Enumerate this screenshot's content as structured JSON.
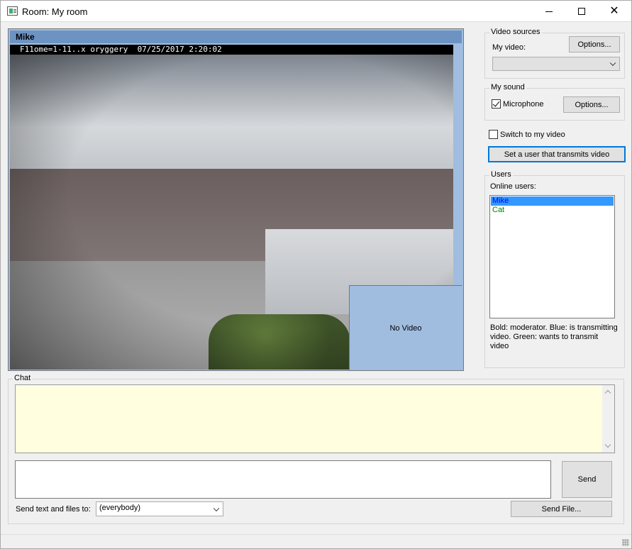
{
  "window": {
    "title": "Room: My room"
  },
  "video": {
    "user_name": "Mike",
    "camera_overlay": "F11ome=1-11..x oryggery  07/25/2017 2:20:02",
    "no_video_label": "No Video"
  },
  "video_sources": {
    "group_label": "Video sources",
    "my_video_label": "My video:",
    "options_label": "Options...",
    "selected": ""
  },
  "my_sound": {
    "group_label": "My sound",
    "microphone_label": "Microphone",
    "microphone_checked": true,
    "options_label": "Options..."
  },
  "switch_to_my_video": {
    "label": "Switch to my video",
    "checked": false
  },
  "set_user_button": "Set a user that transmits video",
  "users": {
    "group_label": "Users",
    "online_label": "Online users:",
    "list": [
      {
        "name": "Mike",
        "state": "transmitting"
      },
      {
        "name": "Cat",
        "state": "wants-to-transmit"
      }
    ],
    "legend": "Bold: moderator. Blue: is transmitting video. Green: wants to transmit video"
  },
  "chat": {
    "group_label": "Chat",
    "log": "",
    "message": "",
    "send_label": "Send",
    "send_to_label": "Send text and files to:",
    "send_to_value": "(everybody)",
    "send_file_label": "Send File..."
  },
  "colors": {
    "video_bg": "#a0bde0",
    "video_header": "#6d93c2",
    "chat_bg": "#ffffe0",
    "selection": "#3399ff",
    "transmitting": "#0000ff",
    "wants_transmit": "#008000"
  }
}
